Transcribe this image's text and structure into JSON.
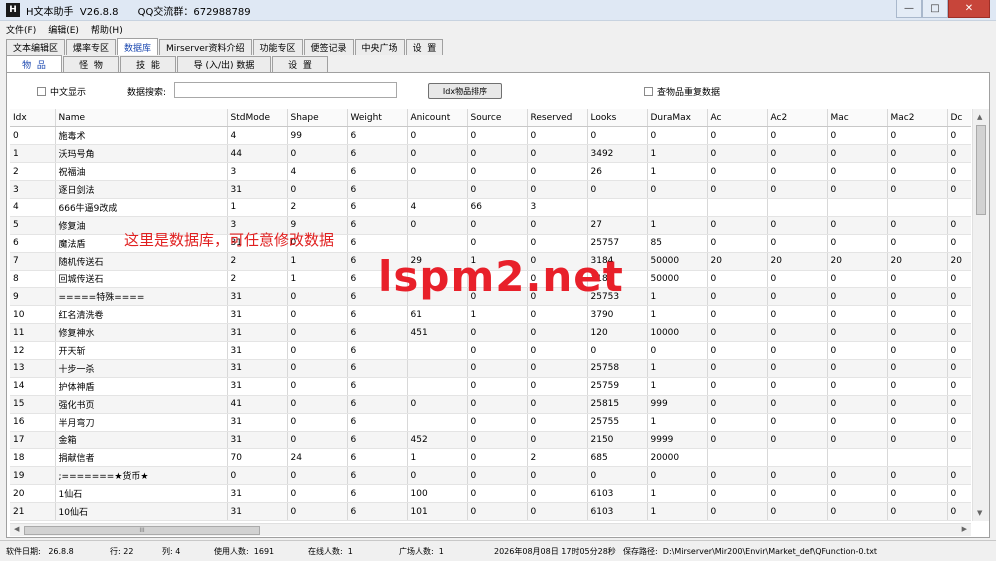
{
  "window": {
    "app_icon": "H",
    "title": "H文本助手  V26.8.8      QQ交流群：672988789",
    "buttons": [
      "—",
      "□",
      "✕"
    ]
  },
  "menu": [
    "文件(F)",
    "编辑(E)",
    "帮助(H)"
  ],
  "main_tabs": [
    "文本编辑区",
    "爆率专区",
    "数据库",
    "Mirserver资料介绍",
    "功能专区",
    "便签记录",
    "中央广场",
    "设  置"
  ],
  "sub_tabs": [
    "物  品",
    "怪  物",
    "技  能",
    "导 (入/出) 数据",
    "设  置"
  ],
  "toolbar": {
    "chinese_display": "中文显示",
    "search_label": "数据搜索:",
    "search_value": "",
    "sort_button": "Idx物品排序",
    "dup_check": "查物品重复数据"
  },
  "grid": {
    "columns": [
      "Idx",
      "Name",
      "StdMode",
      "Shape",
      "Weight",
      "Anicount",
      "Source",
      "Reserved",
      "Looks",
      "DuraMax",
      "Ac",
      "Ac2",
      "Mac",
      "Mac2",
      "Dc"
    ],
    "rows": [
      [
        "0",
        "施毒术",
        "4",
        "99",
        "6",
        "0",
        "0",
        "0",
        "0",
        "0",
        "0",
        "0",
        "0",
        "0",
        "0"
      ],
      [
        "1",
        "沃玛号角",
        "44",
        "0",
        "6",
        "0",
        "0",
        "0",
        "3492",
        "1",
        "0",
        "0",
        "0",
        "0",
        "0"
      ],
      [
        "2",
        "祝福油",
        "3",
        "4",
        "6",
        "0",
        "0",
        "0",
        "26",
        "1",
        "0",
        "0",
        "0",
        "0",
        "0"
      ],
      [
        "3",
        "逐日剑法",
        "31",
        "0",
        "6",
        "",
        "0",
        "0",
        "0",
        "0",
        "0",
        "0",
        "0",
        "0",
        "0"
      ],
      [
        "4",
        "666牛逼9改成",
        "1",
        "2",
        "6",
        "4",
        "66",
        "3",
        "",
        "",
        "",
        "",
        "",
        "",
        ""
      ],
      [
        "5",
        "修复油",
        "3",
        "9",
        "6",
        "0",
        "0",
        "0",
        "27",
        "1",
        "0",
        "0",
        "0",
        "0",
        "0"
      ],
      [
        "6",
        "魔法盾",
        "31",
        "0",
        "6",
        "",
        "0",
        "0",
        "25757",
        "85",
        "0",
        "0",
        "0",
        "0",
        "0"
      ],
      [
        "7",
        "随机传送石",
        "2",
        "1",
        "6",
        "29",
        "1",
        "0",
        "3184",
        "50000",
        "20",
        "20",
        "20",
        "20",
        "20"
      ],
      [
        "8",
        "回城传送石",
        "2",
        "1",
        "6",
        "",
        "0",
        "0",
        "3185",
        "50000",
        "0",
        "0",
        "0",
        "0",
        "0"
      ],
      [
        "9",
        "=====特殊====",
        "31",
        "0",
        "6",
        "",
        "0",
        "0",
        "25753",
        "1",
        "0",
        "0",
        "0",
        "0",
        "0"
      ],
      [
        "10",
        "红名清洗卷",
        "31",
        "0",
        "6",
        "61",
        "1",
        "0",
        "3790",
        "1",
        "0",
        "0",
        "0",
        "0",
        "0"
      ],
      [
        "11",
        "修复神水",
        "31",
        "0",
        "6",
        "451",
        "0",
        "0",
        "120",
        "10000",
        "0",
        "0",
        "0",
        "0",
        "0"
      ],
      [
        "12",
        "开天斩",
        "31",
        "0",
        "6",
        "",
        "0",
        "0",
        "0",
        "0",
        "0",
        "0",
        "0",
        "0",
        "0"
      ],
      [
        "13",
        "十步一杀",
        "31",
        "0",
        "6",
        "",
        "0",
        "0",
        "25758",
        "1",
        "0",
        "0",
        "0",
        "0",
        "0"
      ],
      [
        "14",
        "护体神盾",
        "31",
        "0",
        "6",
        "",
        "0",
        "0",
        "25759",
        "1",
        "0",
        "0",
        "0",
        "0",
        "0"
      ],
      [
        "15",
        "强化书页",
        "41",
        "0",
        "6",
        "0",
        "0",
        "0",
        "25815",
        "999",
        "0",
        "0",
        "0",
        "0",
        "0"
      ],
      [
        "16",
        "半月弯刀",
        "31",
        "0",
        "6",
        "",
        "0",
        "0",
        "25755",
        "1",
        "0",
        "0",
        "0",
        "0",
        "0"
      ],
      [
        "17",
        "金箱",
        "31",
        "0",
        "6",
        "452",
        "0",
        "0",
        "2150",
        "9999",
        "0",
        "0",
        "0",
        "0",
        "0"
      ],
      [
        "18",
        "捐献信者",
        "70",
        "24",
        "6",
        "1",
        "0",
        "2",
        "685",
        "20000",
        "",
        "",
        "",
        "",
        ""
      ],
      [
        "19",
        ";=======★货币★",
        "0",
        "0",
        "6",
        "0",
        "0",
        "0",
        "0",
        "0",
        "0",
        "0",
        "0",
        "0",
        "0"
      ],
      [
        "20",
        "1仙石",
        "31",
        "0",
        "6",
        "100",
        "0",
        "0",
        "6103",
        "1",
        "0",
        "0",
        "0",
        "0",
        "0"
      ],
      [
        "21",
        "10仙石",
        "31",
        "0",
        "6",
        "101",
        "0",
        "0",
        "6103",
        "1",
        "0",
        "0",
        "0",
        "0",
        "0"
      ]
    ]
  },
  "hscroll_grip": "III",
  "overlay_note": "这里是数据库，可任意修改数据",
  "watermark": "lspm2.net",
  "status": {
    "version": "软件日期:   26.8.8",
    "row": "行: 22",
    "col": "列: 4",
    "users": "使用人数:  1691",
    "online": "在线人数:  1",
    "plaza": "广场人数:  1",
    "datetime": "2026年08月08日 17时05分28秒",
    "save_path": "保存路径:  D:\\Mirserver\\Mir200\\Envir\\Market_def\\QFunction-0.txt"
  }
}
